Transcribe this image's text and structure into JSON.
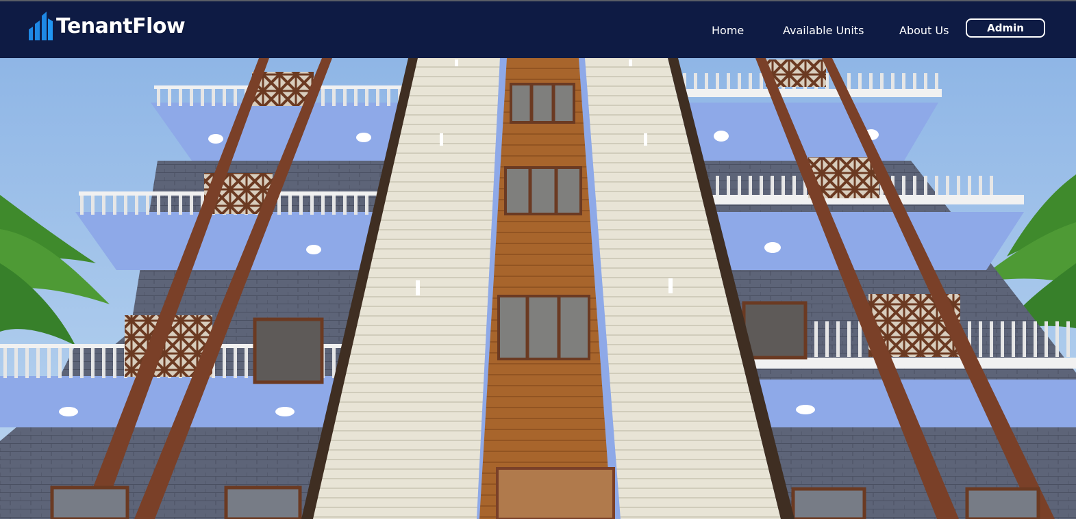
{
  "header": {
    "brand": "TenantFlow",
    "logo_icon": "building-bars-icon",
    "nav": {
      "home": "Home",
      "available_units": "Available Units",
      "about_us": "About Us",
      "admin": "Admin"
    }
  },
  "colors": {
    "navbar": "#0e1b44",
    "logo_accent": "#1e88e5",
    "text": "#ffffff"
  },
  "hero": {
    "image": "apartment-building-photo"
  }
}
